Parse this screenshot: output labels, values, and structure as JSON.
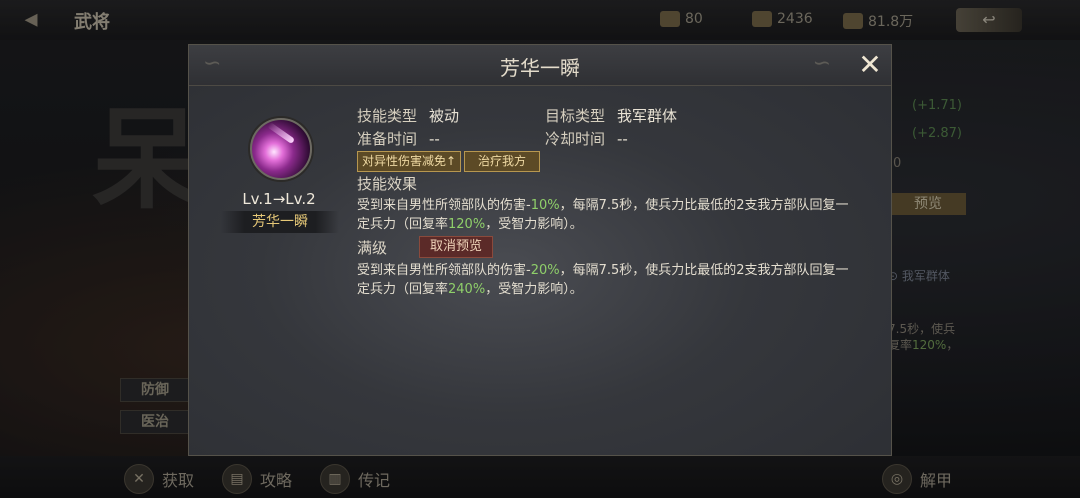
{
  "header": {
    "title": "武将",
    "resources": [
      {
        "icon": "scroll-token-icon",
        "value": "80"
      },
      {
        "icon": "gold-coin-icon",
        "value": "2436"
      },
      {
        "icon": "silver-coin-icon",
        "value": "81.8万"
      }
    ]
  },
  "background": {
    "big_char": "呆",
    "stats": [
      "(+1.71)",
      "(+2.87)"
    ],
    "zero": "0",
    "preview_label": "预览",
    "target_label": "我军群体",
    "text_line1": "7.5秒，使兵",
    "text_line2_prefix": "复率",
    "text_line2_green": "120%",
    "text_line2_suffix": "，",
    "tags": [
      "防御",
      "医治"
    ]
  },
  "bottom_bar": {
    "items": [
      {
        "label": "获取",
        "icon": "obtain-icon"
      },
      {
        "label": "攻略",
        "icon": "guide-book-icon"
      },
      {
        "label": "传记",
        "icon": "biography-icon"
      },
      {
        "label": "解甲",
        "icon": "dismiss-icon"
      }
    ]
  },
  "modal": {
    "title": "芳华一瞬",
    "level_text": "Lv.1→Lv.2",
    "skill_name": "芳华一瞬",
    "skill_type_key": "技能类型",
    "skill_type_value": "被动",
    "target_type_key": "目标类型",
    "target_type_value": "我军群体",
    "prep_time_key": "准备时间",
    "prep_time_value": "--",
    "cooldown_key": "冷却时间",
    "cooldown_value": "--",
    "tags": [
      "对异性伤害减免↑",
      "治疗我方"
    ],
    "effect_label": "技能效果",
    "effect_desc": {
      "p1": "受到来自男性所领部队的伤害-",
      "g1": "10%",
      "p2": "，每隔7.5秒，使兵力比最低的2支我方部队回复一定兵力（回复率",
      "g2": "120%",
      "p3": "，受智力影响）。"
    },
    "max_label": "满级",
    "cancel_preview_label": "取消预览",
    "max_desc": {
      "p1": "受到来自男性所领部队的伤害-",
      "g1": "20%",
      "p2": "，每隔7.5秒，使兵力比最低的2支我方部队回复一定兵力（回复率",
      "g2": "240%",
      "p3": "，受智力影响）。"
    }
  },
  "colors": {
    "accent_gold": "#e6c877",
    "bonus_green": "#8fcf6a",
    "tag_border": "#b7974f"
  }
}
